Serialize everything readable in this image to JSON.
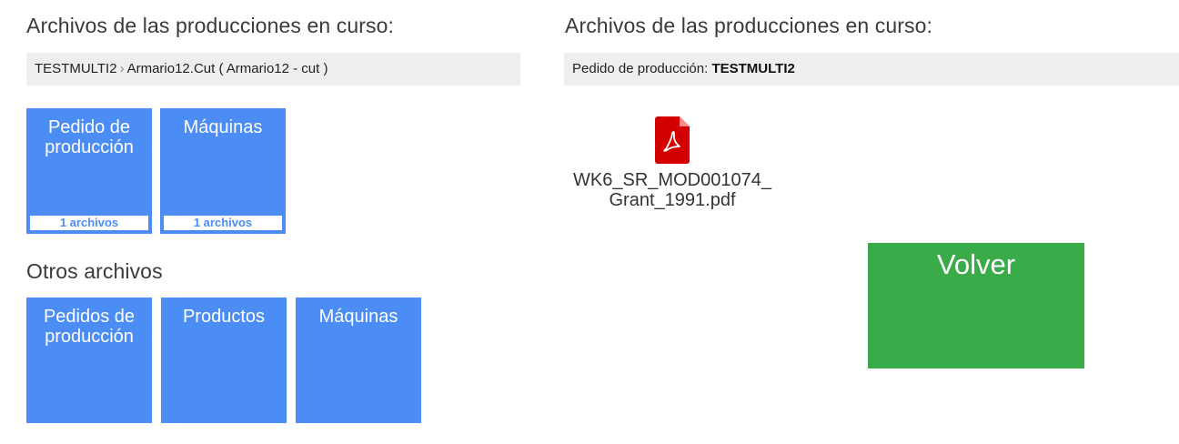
{
  "left_panel": {
    "heading": "Archivos de las producciones en curso:",
    "breadcrumb": {
      "part1": "TESTMULTI2",
      "separator": "›",
      "part2": "Armario12.Cut ( Armario12 - cut )"
    },
    "tiles": [
      {
        "title": "Pedido de\nproducción",
        "count": "1 archivos"
      },
      {
        "title": "Máquinas",
        "count": "1 archivos"
      }
    ],
    "other_heading": "Otros archivos",
    "other_tiles": [
      {
        "title": "Pedidos de\nproducción"
      },
      {
        "title": "Productos"
      },
      {
        "title": "Máquinas"
      }
    ]
  },
  "right_panel": {
    "heading": "Archivos de las producciones en curso:",
    "order_label": "Pedido de producción:",
    "order_value": "TESTMULTI2",
    "file": {
      "name": "WK6_SR_MOD001074_\nGrant_1991.pdf",
      "icon": "pdf-icon"
    },
    "back_button": "Volver"
  },
  "colors": {
    "tile_blue": "#4c8cf5",
    "back_green": "#3aab49",
    "bar_gray": "#eeeeee",
    "pdf_red": "#d40000"
  }
}
